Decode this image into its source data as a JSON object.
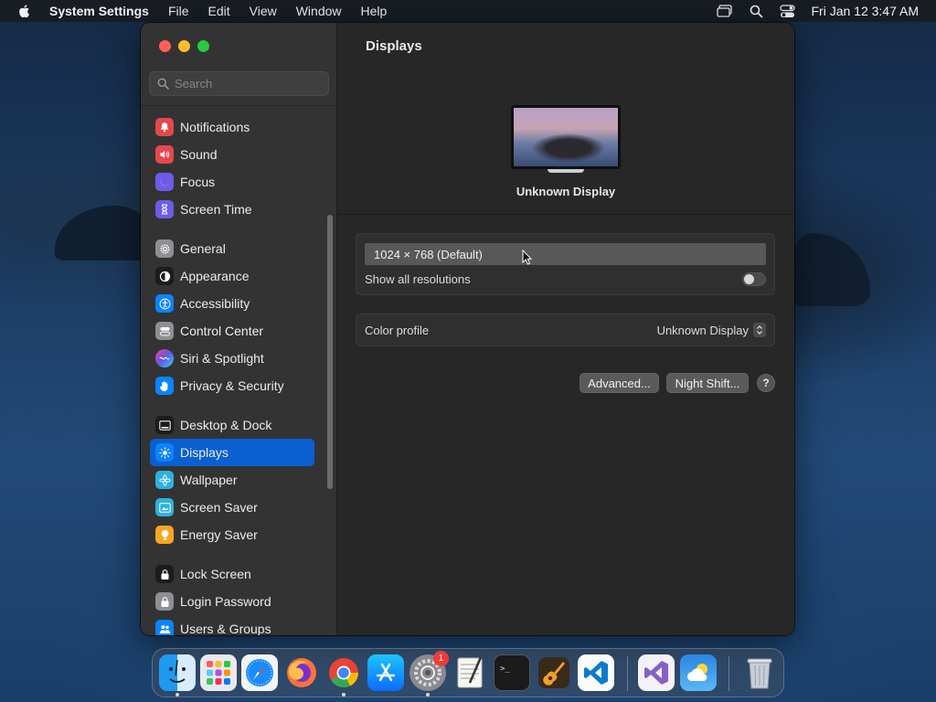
{
  "menubar": {
    "app_name": "System Settings",
    "menus": [
      "File",
      "Edit",
      "View",
      "Window",
      "Help"
    ],
    "clock": "Fri Jan 12  3:47 AM"
  },
  "window": {
    "title": "Displays",
    "search_placeholder": "Search"
  },
  "sidebar": {
    "groups": [
      [
        {
          "label": "Notifications",
          "icon": "bell-icon",
          "color": "#e5484d"
        },
        {
          "label": "Sound",
          "icon": "speaker-icon",
          "color": "#e5484d"
        },
        {
          "label": "Focus",
          "icon": "moon-icon",
          "color": "#6c5ce7"
        },
        {
          "label": "Screen Time",
          "icon": "hourglass-icon",
          "color": "#6c5ce7"
        }
      ],
      [
        {
          "label": "General",
          "icon": "gear-icon",
          "color": "#8e8e93"
        },
        {
          "label": "Appearance",
          "icon": "appearance-icon",
          "color": "#1c1c1e"
        },
        {
          "label": "Accessibility",
          "icon": "accessibility-icon",
          "color": "#0a84ff"
        },
        {
          "label": "Control Center",
          "icon": "control-center-icon",
          "color": "#8e8e93"
        },
        {
          "label": "Siri & Spotlight",
          "icon": "siri-icon",
          "color": "#b04ad8"
        },
        {
          "label": "Privacy & Security",
          "icon": "hand-icon",
          "color": "#0a84ff"
        }
      ],
      [
        {
          "label": "Desktop & Dock",
          "icon": "dock-icon",
          "color": "#1c1c1e"
        },
        {
          "label": "Displays",
          "icon": "sun-icon",
          "color": "#0a84ff",
          "active": true
        },
        {
          "label": "Wallpaper",
          "icon": "flower-icon",
          "color": "#30b0e0"
        },
        {
          "label": "Screen Saver",
          "icon": "screensaver-icon",
          "color": "#30b0e0"
        },
        {
          "label": "Energy Saver",
          "icon": "bulb-icon",
          "color": "#f5a623"
        }
      ],
      [
        {
          "label": "Lock Screen",
          "icon": "lock-icon",
          "color": "#1c1c1e"
        },
        {
          "label": "Login Password",
          "icon": "padlock-icon",
          "color": "#8e8e93"
        },
        {
          "label": "Users & Groups",
          "icon": "users-icon",
          "color": "#0a84ff"
        }
      ]
    ]
  },
  "display": {
    "name": "Unknown Display",
    "resolution": "1024 × 768 (Default)",
    "show_all_label": "Show all resolutions",
    "show_all_enabled": false,
    "color_profile_label": "Color profile",
    "color_profile_value": "Unknown Display",
    "advanced_label": "Advanced...",
    "night_shift_label": "Night Shift...",
    "help_label": "?"
  },
  "dock": {
    "apps": [
      {
        "name": "finder-icon",
        "running": true
      },
      {
        "name": "launchpad-icon",
        "running": false
      },
      {
        "name": "safari-icon",
        "running": false
      },
      {
        "name": "firefox-icon",
        "running": false
      },
      {
        "name": "chrome-icon",
        "running": true
      },
      {
        "name": "app-store-icon",
        "running": false
      },
      {
        "name": "system-settings-icon",
        "running": true,
        "badge": "1"
      },
      {
        "name": "textedit-icon",
        "running": false
      },
      {
        "name": "terminal-icon",
        "running": false
      },
      {
        "name": "garageband-icon",
        "running": false
      },
      {
        "name": "vscode-icon",
        "running": false
      },
      {
        "name": "visual-studio-icon",
        "running": false
      },
      {
        "name": "weather-icon",
        "running": false
      },
      {
        "name": "trash-icon",
        "running": false
      }
    ]
  }
}
